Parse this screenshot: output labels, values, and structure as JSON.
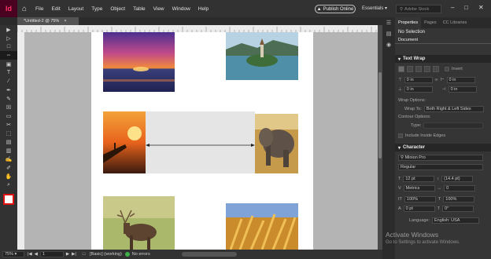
{
  "app": {
    "logo": "Id",
    "menu": [
      "File",
      "Edit",
      "Layout",
      "Type",
      "Object",
      "Table",
      "View",
      "Window",
      "Help"
    ],
    "publish_label": "Publish Online",
    "workspace": "Essentials",
    "stock_placeholder": "Adobe Stock"
  },
  "document": {
    "tab_label": "*Untitled-2 @ 75%",
    "zoom": "75%",
    "page_number": "1",
    "preflight_profile": "[Basic] (working)",
    "preflight_status": "No errors"
  },
  "tools": [
    "select-tool",
    "direct-select-tool",
    "page-tool",
    "gap-tool",
    "content-collector-tool",
    "type-tool",
    "line-tool",
    "pen-tool",
    "pencil-tool",
    "rectangle-frame-tool",
    "rectangle-tool",
    "scissors-tool",
    "free-transform-tool",
    "gradient-tool",
    "gradient-feather-tool",
    "note-tool",
    "eyedropper-tool",
    "hand-tool",
    "zoom-tool"
  ],
  "panel": {
    "tabs": [
      "Properties",
      "Pages",
      "CC Libraries"
    ],
    "selection_text": "No Selection",
    "document_label": "Document",
    "text_wrap": {
      "title": "Text Wrap",
      "invert_label": "Invert",
      "offsets": [
        "0 in",
        "0 in",
        "0 in",
        "0 in"
      ],
      "wrap_options_label": "Wrap Options:",
      "wrap_to_label": "Wrap To:",
      "wrap_to_value": "Both Right & Left Sides",
      "contour_label": "Contour Options:",
      "type_label": "Type:",
      "include_edges_label": "Include Inside Edges"
    },
    "character": {
      "title": "Character",
      "font": "Minion Pro",
      "style": "Regular",
      "size": "12 pt",
      "leading": "(14.4 pt)",
      "kerning": "Metrics",
      "tracking": "0",
      "vscale": "100%",
      "hscale": "100%",
      "baseline": "0 pt",
      "skew": "0°",
      "language_label": "Language:",
      "language": "English: USA"
    }
  },
  "watermark": {
    "title": "Activate Windows",
    "subtitle": "Go to Settings to activate Windows."
  }
}
